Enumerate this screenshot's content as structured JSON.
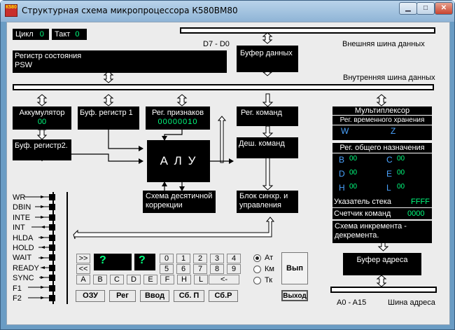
{
  "window": {
    "title": "Структурная схема микропроцессора К580ВМ80",
    "icon_text": "К580"
  },
  "header": {
    "cycle_label": "Цикл",
    "cycle_value": "0",
    "tact_label": "Такт",
    "tact_value": "0"
  },
  "buses": {
    "d7_d0": "D7 - D0",
    "external": "Внешняя шина данных",
    "internal": "Внутренняя шина данных",
    "address_range": "A0 - A15",
    "address": "Шина адреса"
  },
  "blocks": {
    "status_register_line1": "Регистр состояния",
    "status_register_line2": "PSW",
    "data_buffer": "Буфер данных",
    "accumulator": "Аккумулятор",
    "accumulator_value": "00",
    "buffer_register1": "Буф. регистр 1",
    "flags_register": "Рег. признаков",
    "flags_value": "00000010",
    "command_register": "Рег. команд",
    "buffer_register2": "Буф. регистр2.",
    "alu": "А Л У",
    "command_decoder": "Деш. команд",
    "decimal_correction_line1": "Схема десятичной",
    "decimal_correction_line2": "коррекции",
    "sync_control_line1": "Блок синхр. и",
    "sync_control_line2": "управления"
  },
  "right_panel": {
    "multiplexer": "Мультиплексор",
    "temp_registers": "Рег. временного хранения",
    "w": "W",
    "z": "Z",
    "general_registers": "Рег. общего назначения",
    "regs": [
      {
        "n": "B",
        "v": "00"
      },
      {
        "n": "C",
        "v": "00"
      },
      {
        "n": "D",
        "v": "00"
      },
      {
        "n": "E",
        "v": "00"
      },
      {
        "n": "H",
        "v": "00"
      },
      {
        "n": "L",
        "v": "00"
      }
    ],
    "stack_pointer": "Указатель стека",
    "stack_value": "FFFF",
    "program_counter": "Счетчик команд",
    "pc_value": "0000",
    "incrementer_line1": "Схема  инкремента -",
    "incrementer_line2": "декремента.",
    "address_buffer": "Буфер адреса"
  },
  "signals": [
    "WR",
    "DBIN",
    "INTE",
    "INT",
    "HLDA",
    "HOLD",
    "WAIT",
    "READY",
    "SYNC",
    "F1",
    "F2"
  ],
  "keypad": {
    "nav_forward": ">>",
    "nav_back": "<<",
    "display1": "?",
    "display2": "?",
    "digits_row1": [
      "0",
      "1",
      "2",
      "3",
      "4"
    ],
    "digits_row2": [
      "5",
      "6",
      "7",
      "8",
      "9"
    ],
    "letters": [
      "A",
      "B",
      "C",
      "D",
      "E",
      "F",
      "H",
      "L"
    ],
    "backspace": "<-"
  },
  "radio": {
    "options": [
      "Ат",
      "Км",
      "Тк"
    ],
    "selected": "Ат"
  },
  "buttons": {
    "run": "Вып",
    "exit": "Выход",
    "ram": "ОЗУ",
    "reg": "Рег",
    "input": "Ввод",
    "reset_p": "Сб. П",
    "reset_r": "Сб.Р"
  }
}
